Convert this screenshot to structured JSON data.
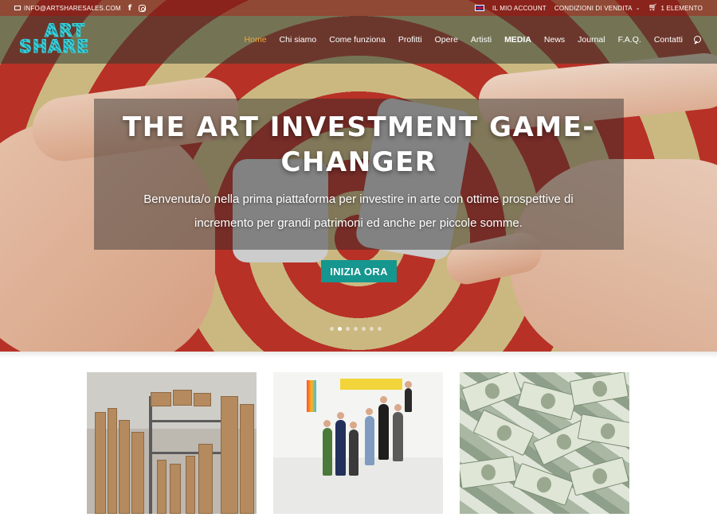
{
  "top_bar": {
    "email": "INFO@ARTSHARESALES.COM",
    "account": "IL MIO ACCOUNT",
    "terms": "CONDIZIONI DI VENDITA",
    "cart": "1 ELEMENTO"
  },
  "logo": {
    "line1": "ART",
    "line2": "SHARE"
  },
  "nav": {
    "items": [
      {
        "label": "Home",
        "active": true
      },
      {
        "label": "Chi siamo"
      },
      {
        "label": "Come funziona"
      },
      {
        "label": "Profitti"
      },
      {
        "label": "Opere"
      },
      {
        "label": "Artisti"
      },
      {
        "label": "MEDIA",
        "bold": true
      },
      {
        "label": "News"
      },
      {
        "label": "Journal"
      },
      {
        "label": "F.A.Q."
      },
      {
        "label": "Contatti"
      }
    ]
  },
  "hero": {
    "title": "THE ART INVESTMENT GAME-CHANGER",
    "subtitle": "Benvenuta/o nella prima piattaforma per investire in arte con ottime prospettive di incremento per grandi patrimoni ed anche per piccole somme.",
    "cta": "INIZIA ORA",
    "slide_count": 7,
    "active_slide": 2
  },
  "colors": {
    "accent": "#f0a63a",
    "cta": "#15968f",
    "logo": "#3bd3d8"
  }
}
